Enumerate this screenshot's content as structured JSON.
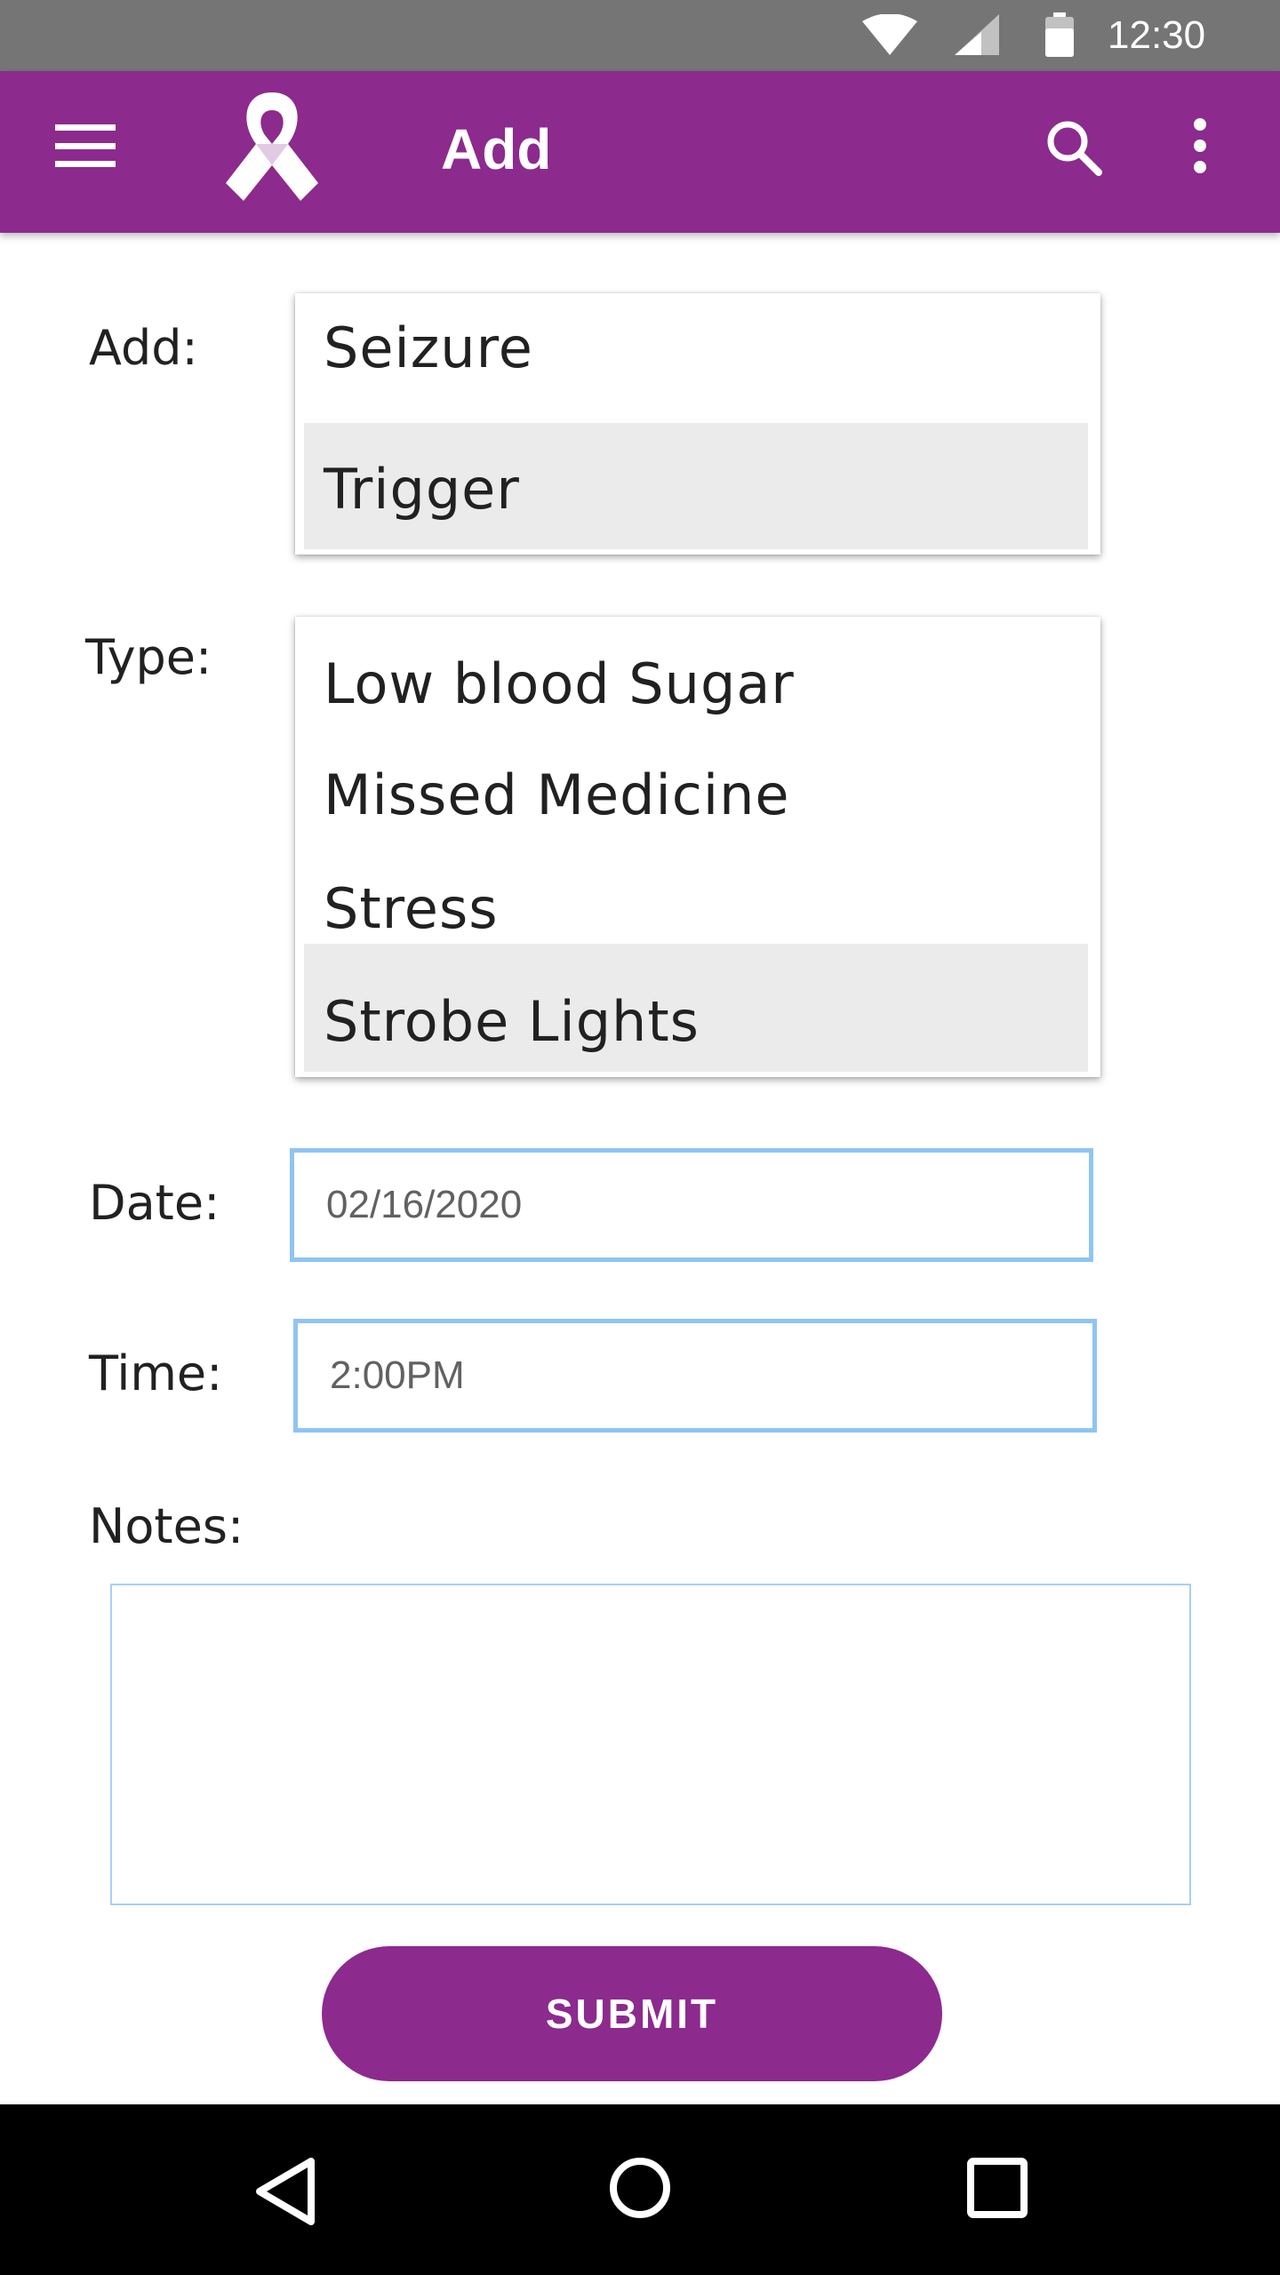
{
  "status_bar": {
    "time": "12:30",
    "icons": [
      "wifi-icon",
      "signal-icon",
      "battery-icon"
    ]
  },
  "app_bar": {
    "title": "Add",
    "color": "#8c2a8e",
    "icons": [
      "menu-icon",
      "ribbon-logo",
      "search-icon",
      "more-vert-icon"
    ]
  },
  "form": {
    "add_label": "Add:",
    "add_options": [
      {
        "label": "Seizure",
        "selected": false
      },
      {
        "label": "Trigger",
        "selected": true
      }
    ],
    "type_label": "Type:",
    "type_options": [
      {
        "label": "Low blood Sugar",
        "selected": false
      },
      {
        "label": "Missed Medicine",
        "selected": false
      },
      {
        "label": "Stress",
        "selected": false
      },
      {
        "label": "Strobe Lights",
        "selected": true
      }
    ],
    "date_label": "Date:",
    "date_value": "02/16/2020",
    "time_label": "Time:",
    "time_value": "2:00PM",
    "notes_label": "Notes:",
    "notes_value": "",
    "submit_label": "SUBMIT"
  },
  "nav_bar": {
    "icons": [
      "back-icon",
      "home-icon",
      "recents-icon"
    ]
  }
}
